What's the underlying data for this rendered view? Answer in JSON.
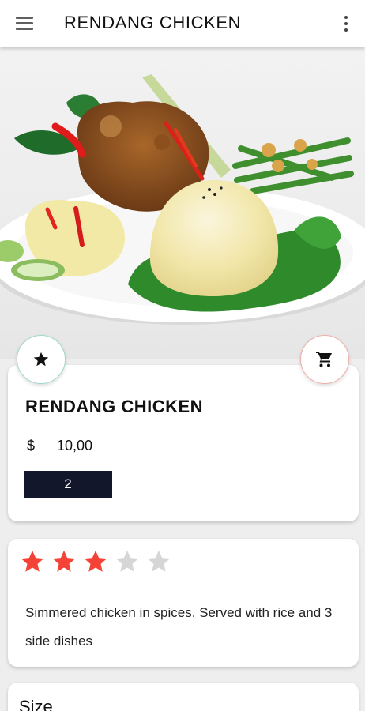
{
  "appbar": {
    "title": "RENDANG CHICKEN",
    "menu_icon": "hamburger-menu-icon",
    "more_icon": "more-vertical-icon"
  },
  "hero": {
    "image": "rendang-chicken-plate"
  },
  "actions": {
    "favorite_icon": "star-icon",
    "cart_icon": "shopping-cart-icon"
  },
  "product": {
    "name": "RENDANG CHICKEN",
    "currency": "$",
    "price": "10,00",
    "quantity": "2"
  },
  "rating": {
    "value": 3,
    "max": 5,
    "filled_color": "#f44336",
    "empty_color": "#d6d6d6"
  },
  "description": "Simmered chicken in spices. Served with rice and 3 side dishes",
  "size": {
    "label": "Size"
  }
}
